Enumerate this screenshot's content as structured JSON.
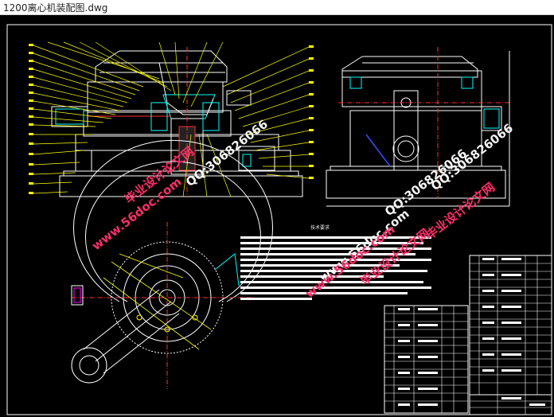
{
  "window": {
    "title": "1200离心机装配图.dwg"
  },
  "drawing": {
    "notes_title": "技术要求",
    "colors": {
      "background": "#000000",
      "outline": "#ffffff",
      "leader": "#ffff00",
      "center": "#ff3030",
      "cyan": "#00ffff",
      "green": "#00ff00",
      "blue": "#3050ff",
      "magenta": "#ff00ff"
    },
    "watermarks": [
      {
        "text": "毕业设计论文网",
        "color": "red"
      },
      {
        "text": "www.56doc.com",
        "color": "red"
      },
      {
        "text": "QQ:306826066",
        "color": "white"
      },
      {
        "text": "www.56doc.com",
        "color": "white"
      },
      {
        "text": "QQ:306826066",
        "color": "white"
      },
      {
        "text": "毕业设计论文网",
        "color": "red"
      },
      {
        "text": "www.56doc.com",
        "color": "red"
      },
      {
        "text": "QQ:306826066",
        "color": "white"
      },
      {
        "text": "毕业设计论文网",
        "color": "red"
      }
    ]
  }
}
